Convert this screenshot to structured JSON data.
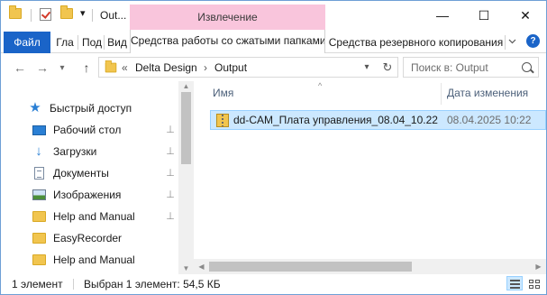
{
  "titlebar": {
    "title": "Out...",
    "context_tab_group": "Извлечение",
    "minimize_glyph": "—",
    "maximize_glyph": "☐",
    "close_glyph": "✕",
    "quick_access_dropdown": "▾"
  },
  "ribbon": {
    "tabs": [
      {
        "label": "Файл"
      },
      {
        "label": "Гла"
      },
      {
        "label": "Под"
      },
      {
        "label": "Вид"
      },
      {
        "label": "Средства работы со сжатыми папками"
      },
      {
        "label": "Средства резервного копирования"
      }
    ],
    "help_label": "?"
  },
  "navigation": {
    "back_glyph": "←",
    "forward_glyph": "→",
    "recent_glyph": "▾",
    "up_glyph": "↑",
    "address": {
      "overflow": "«",
      "crumbs": [
        "Delta Design",
        "Output"
      ],
      "separator": "›",
      "dropdown_glyph": "▾",
      "refresh_glyph": "↻"
    },
    "search_placeholder": "Поиск в: Output"
  },
  "sidebar": {
    "items": [
      {
        "label": "Быстрый доступ",
        "icon": "star-icon",
        "pinned": false
      },
      {
        "label": "Рабочий стол",
        "icon": "desktop-icon",
        "pinned": true
      },
      {
        "label": "Загрузки",
        "icon": "download-icon",
        "pinned": true
      },
      {
        "label": "Документы",
        "icon": "documents-icon",
        "pinned": true
      },
      {
        "label": "Изображения",
        "icon": "pictures-icon",
        "pinned": true
      },
      {
        "label": "Help and Manual",
        "icon": "folder-icon",
        "pinned": true
      },
      {
        "label": "EasyRecorder",
        "icon": "folder-icon",
        "pinned": false
      },
      {
        "label": "Help and Manual",
        "icon": "folder-icon",
        "pinned": false
      }
    ],
    "pin_glyph": "📌"
  },
  "file_list": {
    "columns": [
      "Имя",
      "Дата изменения"
    ],
    "sort_glyph": "^",
    "rows": [
      {
        "name": "dd-CAM_Плата управления_08.04_10.22",
        "modified": "08.04.2025 10:22",
        "icon": "zip-folder-icon",
        "selected": true
      }
    ]
  },
  "statusbar": {
    "item_count": "1 элемент",
    "selection": "Выбран 1 элемент: 54,5 КБ"
  },
  "colors": {
    "accent": "#1a64c8",
    "context_tab": "#f9c5dc",
    "selection": "#cce8ff",
    "selection_border": "#99d1ff"
  }
}
